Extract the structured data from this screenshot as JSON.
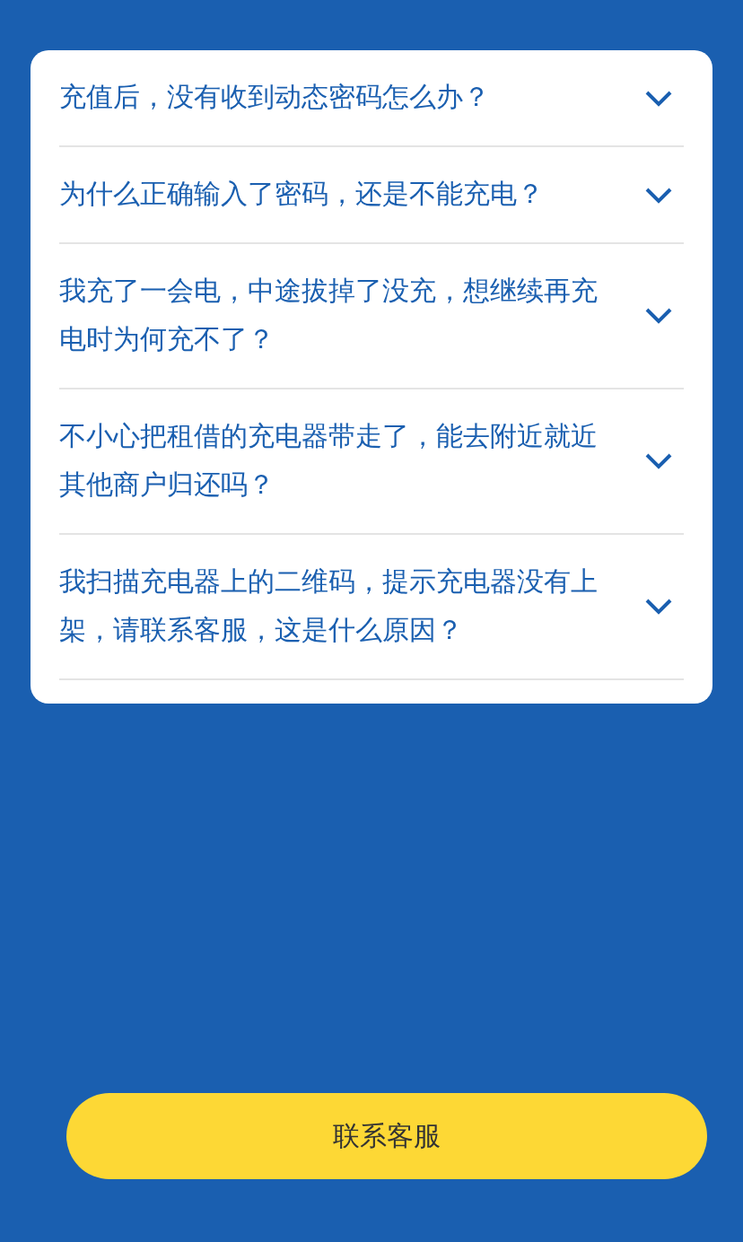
{
  "faq": [
    {
      "question": "充值后，没有收到动态密码怎么办？"
    },
    {
      "question": "为什么正确输入了密码，还是不能充电？"
    },
    {
      "question": "我充了一会电，中途拔掉了没充，想继续再充电时为何充不了？"
    },
    {
      "question": "不小心把租借的充电器带走了，能去附近就近其他商户归还吗？"
    },
    {
      "question": "我扫描充电器上的二维码，提示充电器没有上架，请联系客服，这是什么原因？"
    }
  ],
  "contact_button": "联系客服"
}
